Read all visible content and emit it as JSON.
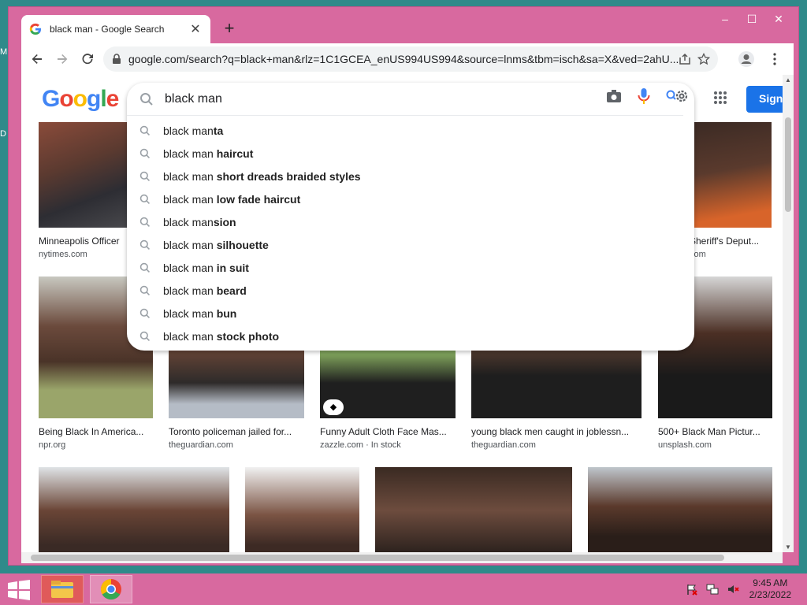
{
  "desktop": {
    "letters": [
      "M",
      "D"
    ]
  },
  "window": {
    "controls": {
      "minimize": "–",
      "maximize": "☐",
      "close": "✕"
    }
  },
  "tab": {
    "title": "black man - Google Search",
    "close": "✕"
  },
  "new_tab": "+",
  "toolbar": {
    "url": "google.com/search?q=black+man&rlz=1C1GCEA_enUS994US994&source=lnms&tbm=isch&sa=X&ved=2ahU..."
  },
  "google": {
    "logo": [
      "G",
      "o",
      "o",
      "g",
      "l",
      "e"
    ],
    "logo_colors": [
      "#4285f4",
      "#ea4335",
      "#fbbc05",
      "#4285f4",
      "#34a853",
      "#ea4335"
    ],
    "signin": "Sign in"
  },
  "search": {
    "value": "black man",
    "suggestions": [
      {
        "prefix": "black man",
        "bold": "ta"
      },
      {
        "prefix": "black man ",
        "bold": "haircut"
      },
      {
        "prefix": "black man ",
        "bold": "short dreads braided styles"
      },
      {
        "prefix": "black man ",
        "bold": "low fade haircut"
      },
      {
        "prefix": "black man",
        "bold": "sion"
      },
      {
        "prefix": "black man ",
        "bold": "silhouette"
      },
      {
        "prefix": "black man ",
        "bold": "in suit"
      },
      {
        "prefix": "black man ",
        "bold": "beard"
      },
      {
        "prefix": "black man ",
        "bold": "bun"
      },
      {
        "prefix": "black man ",
        "bold": "stock photo"
      }
    ]
  },
  "results": {
    "row1": [
      {
        "caption": "Minneapolis Officer",
        "source": "nytimes.com"
      },
      {
        "caption": "Sheriff's Deput...",
        "source": "com"
      }
    ],
    "row2": [
      {
        "caption": "Being Black In America...",
        "source": "npr.org"
      },
      {
        "caption": "Toronto policeman jailed for...",
        "source": "theguardian.com"
      },
      {
        "caption": "Funny Adult Cloth Face Mas...",
        "source": "zazzle.com · In stock"
      },
      {
        "caption": "young black men caught in joblessn...",
        "source": "theguardian.com"
      },
      {
        "caption": "500+ Black Man Pictur...",
        "source": "unsplash.com"
      }
    ]
  },
  "taskbar": {
    "time": "9:45 AM",
    "date": "2/23/2022"
  },
  "colors": {
    "frame": "#d8699f",
    "accent": "#1a73e8"
  }
}
